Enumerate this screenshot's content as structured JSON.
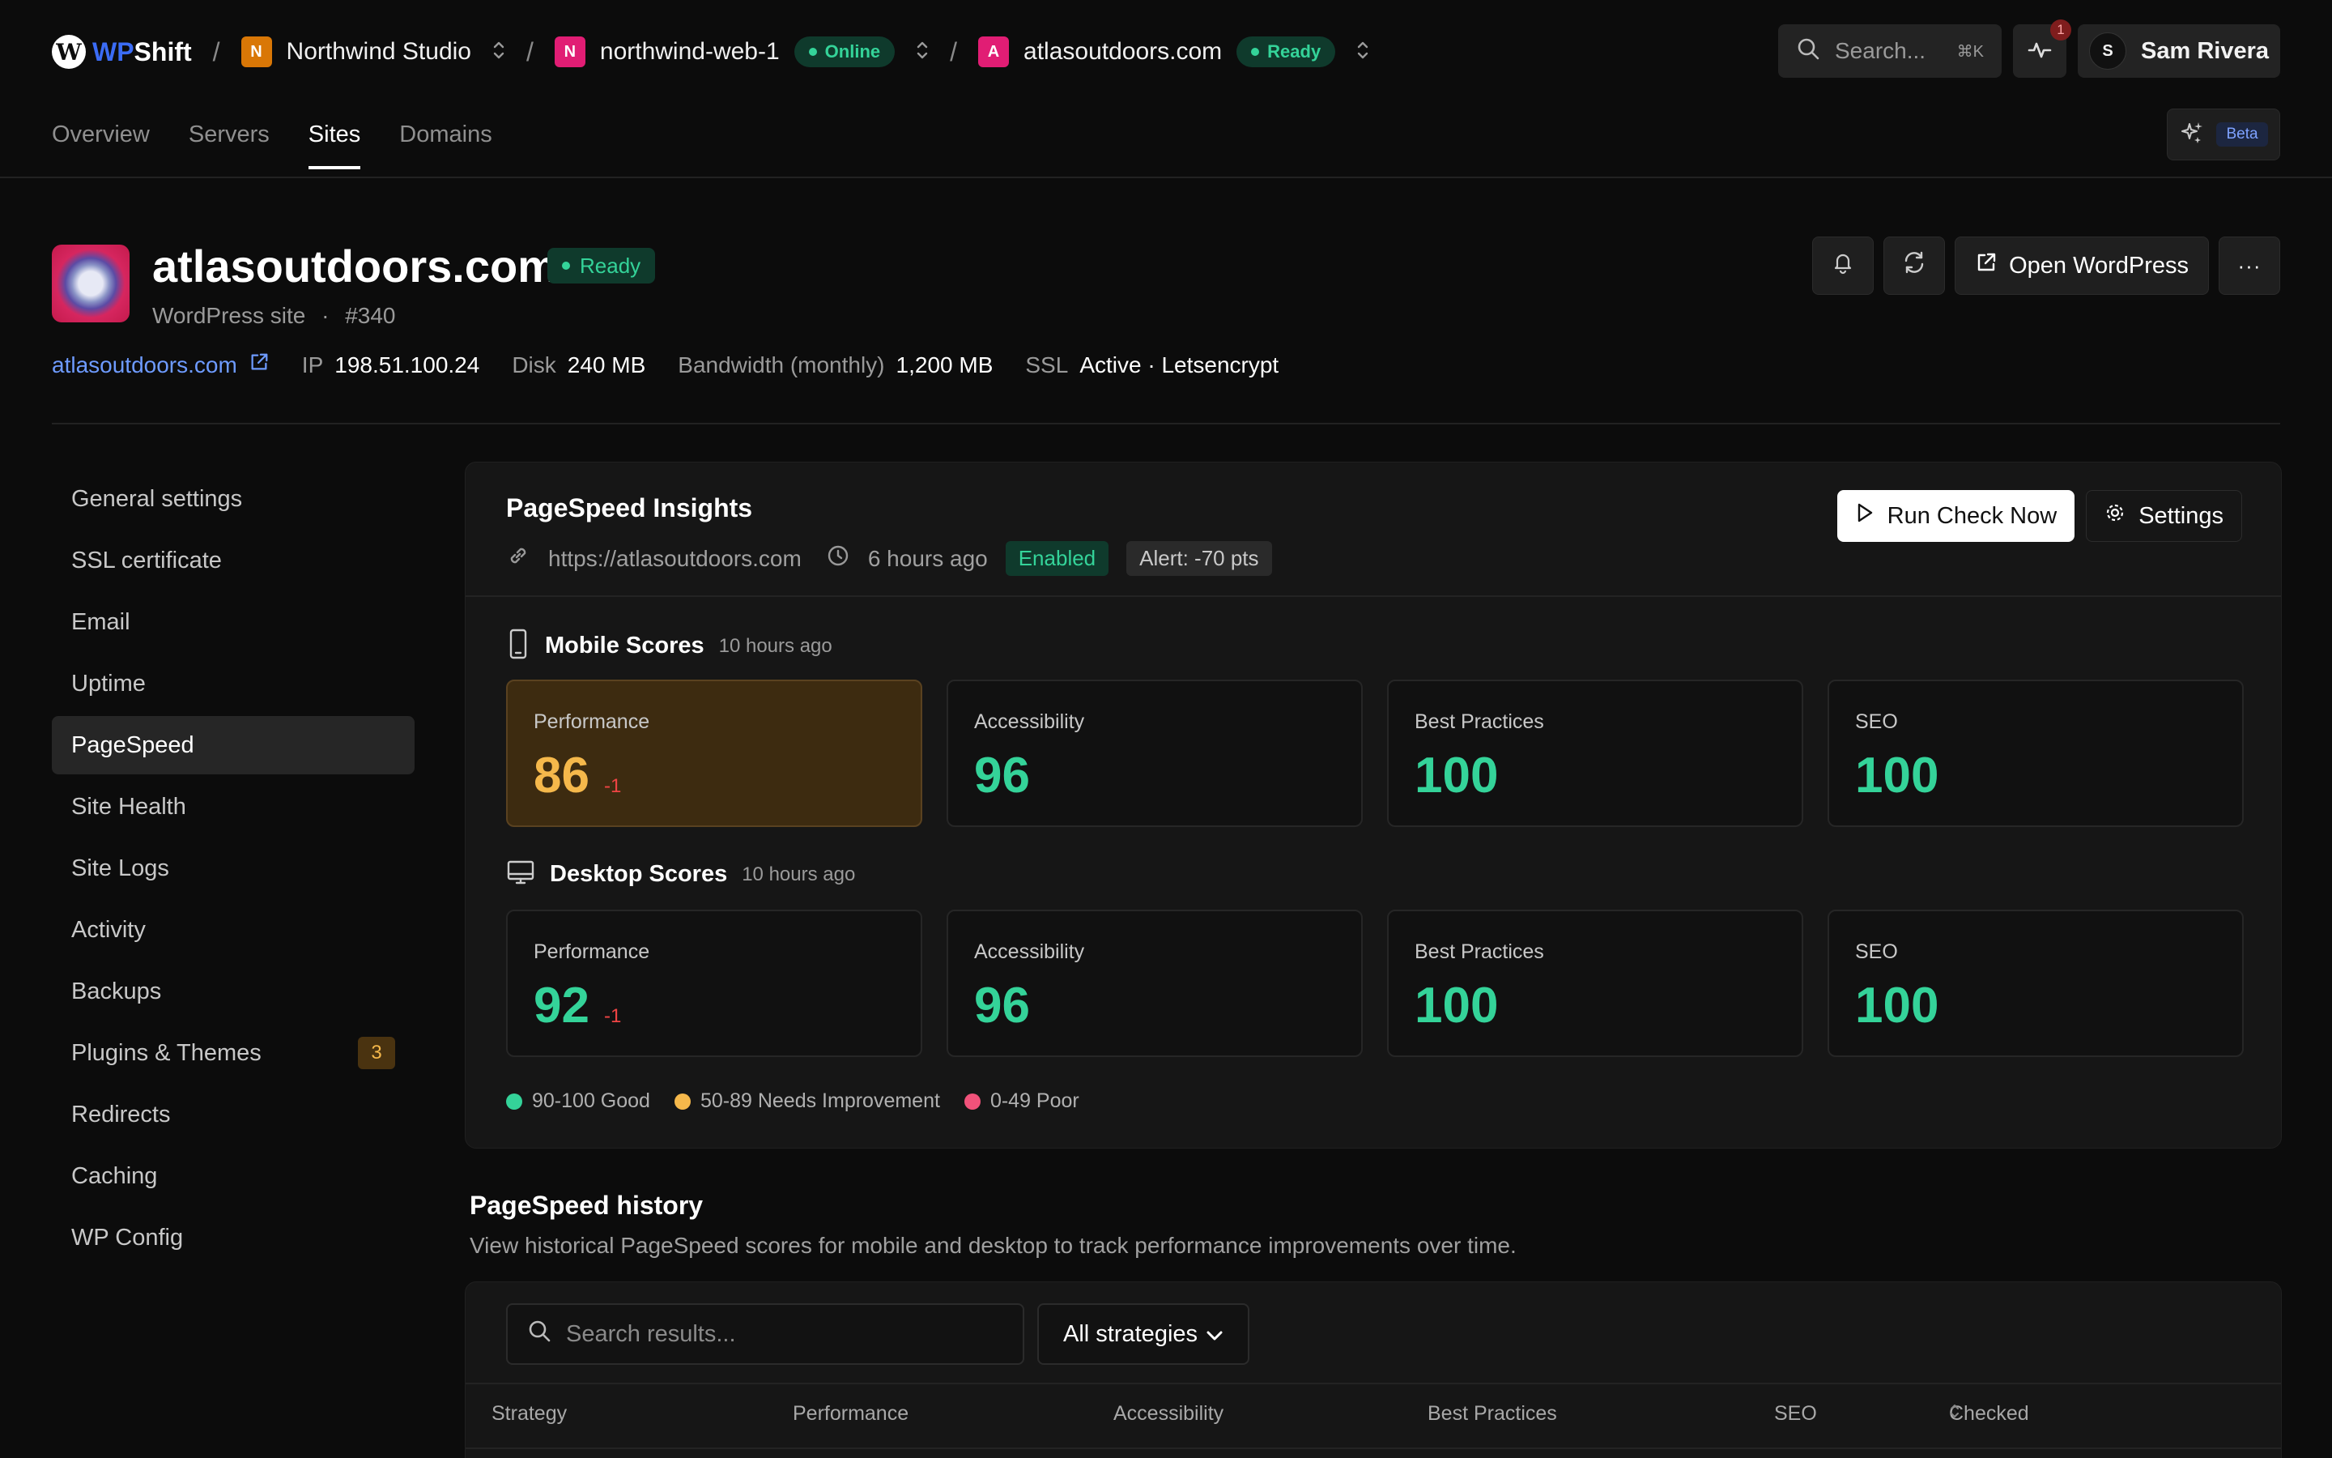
{
  "brand": {
    "wp": "WP",
    "shift": "Shift",
    "glyph": "W"
  },
  "breadcrumb": {
    "org": {
      "initial": "N",
      "name": "Northwind Studio",
      "color": "#d97706"
    },
    "server": {
      "initial": "N",
      "name": "northwind-web-1",
      "status": "Online",
      "color": "#e11d74"
    },
    "site": {
      "initial": "A",
      "name": "atlasoutdoors.com",
      "status": "Ready",
      "color": "#e11d74"
    },
    "separator": "/"
  },
  "search": {
    "placeholder": "Search...",
    "shortcut": "⌘K"
  },
  "activity": {
    "badge": "1"
  },
  "user": {
    "initial": "S",
    "name": "Sam Rivera"
  },
  "tabs": [
    {
      "label": "Overview",
      "active": false
    },
    {
      "label": "Servers",
      "active": false
    },
    {
      "label": "Sites",
      "active": true
    },
    {
      "label": "Domains",
      "active": false
    }
  ],
  "ai": {
    "badge": "Beta"
  },
  "site": {
    "title": "atlasoutdoors.com",
    "status": "Ready",
    "type": "WordPress site",
    "id": "#340",
    "open_label": "Open WordPress",
    "more_label": "···",
    "domain": "atlasoutdoors.com",
    "ip_label": "IP",
    "ip": "198.51.100.24",
    "disk_label": "Disk",
    "disk": "240 MB",
    "bw_label": "Bandwidth (monthly)",
    "bw": "1,200 MB",
    "ssl_label": "SSL",
    "ssl": "Active · Letsencrypt"
  },
  "sidenav": [
    {
      "label": "General settings"
    },
    {
      "label": "SSL certificate"
    },
    {
      "label": "Email"
    },
    {
      "label": "Uptime"
    },
    {
      "label": "PageSpeed",
      "active": true
    },
    {
      "label": "Site Health"
    },
    {
      "label": "Site Logs"
    },
    {
      "label": "Activity"
    },
    {
      "label": "Backups"
    },
    {
      "label": "Plugins & Themes",
      "count": "3"
    },
    {
      "label": "Redirects"
    },
    {
      "label": "Caching"
    },
    {
      "label": "WP Config"
    }
  ],
  "pagespeed": {
    "title": "PageSpeed Insights",
    "url": "https://atlasoutdoors.com",
    "last_run": "6 hours ago",
    "status": "Enabled",
    "alert": "Alert: -70 pts",
    "run_label": "Run Check Now",
    "settings_label": "Settings",
    "mobile": {
      "title": "Mobile Scores",
      "time": "10 hours ago",
      "scores": [
        {
          "label": "Performance",
          "value": "86",
          "delta": "-1"
        },
        {
          "label": "Accessibility",
          "value": "96"
        },
        {
          "label": "Best Practices",
          "value": "100"
        },
        {
          "label": "SEO",
          "value": "100"
        }
      ]
    },
    "desktop": {
      "title": "Desktop Scores",
      "time": "10 hours ago",
      "scores": [
        {
          "label": "Performance",
          "value": "92",
          "delta": "-1"
        },
        {
          "label": "Accessibility",
          "value": "96"
        },
        {
          "label": "Best Practices",
          "value": "100"
        },
        {
          "label": "SEO",
          "value": "100"
        }
      ]
    },
    "legend": [
      {
        "label": "90-100 Good",
        "color": "#34d399"
      },
      {
        "label": "50-89 Needs Improvement",
        "color": "#f5b84b"
      },
      {
        "label": "0-49 Poor",
        "color": "#f0527a"
      }
    ]
  },
  "history": {
    "title": "PageSpeed history",
    "description": "View historical PageSpeed scores for mobile and desktop to track performance improvements over time.",
    "search_placeholder": "Search results...",
    "filter": "All strategies",
    "columns": [
      "Strategy",
      "Performance",
      "Accessibility",
      "Best Practices",
      "SEO",
      "Checked"
    ]
  }
}
